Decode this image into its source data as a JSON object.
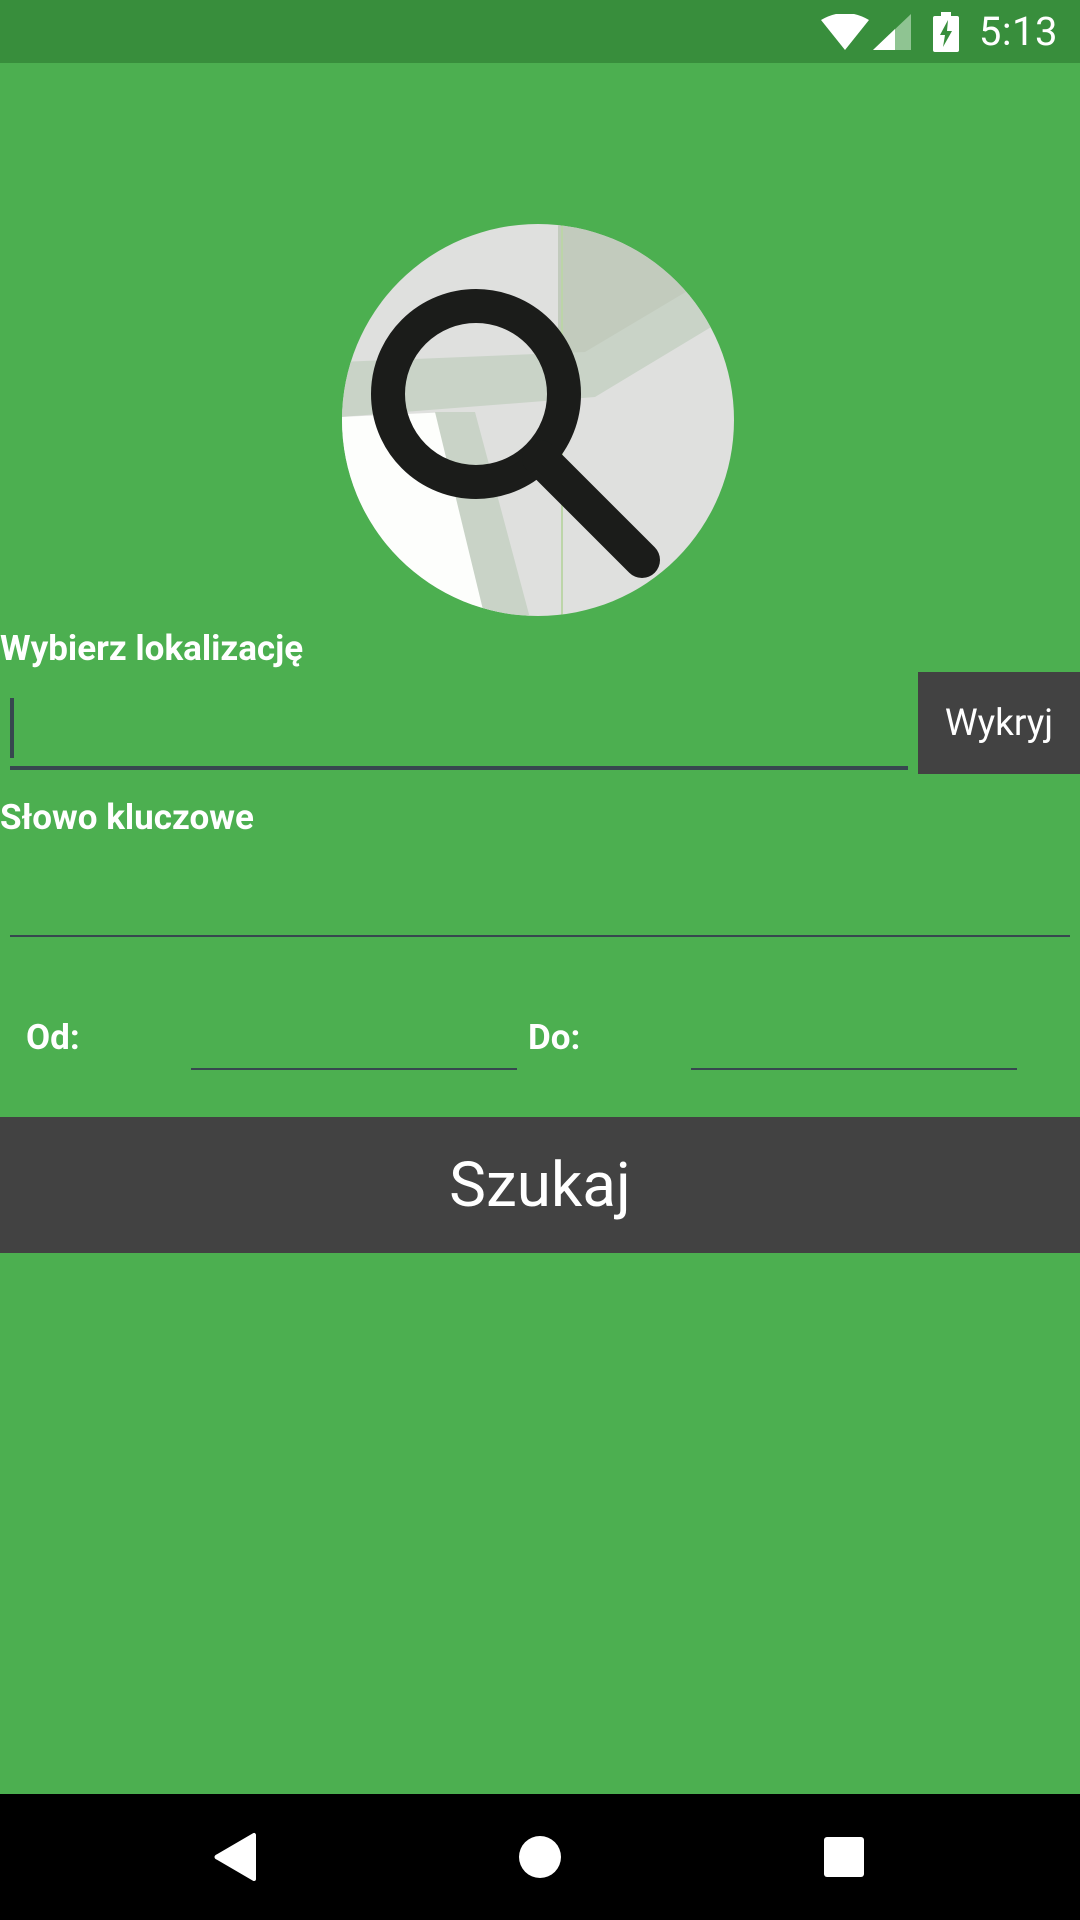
{
  "status_bar": {
    "time": "5:13",
    "icons": [
      "wifi-icon",
      "cell-signal-icon",
      "battery-charging-icon"
    ],
    "background": "#388e3c"
  },
  "logo": {
    "icon": "map-search-icon"
  },
  "location": {
    "label": "Wybierz lokalizację",
    "value": "",
    "placeholder": "",
    "detect_button": "Wykryj"
  },
  "keyword": {
    "label": "Słowo kluczowe",
    "value": "",
    "placeholder": ""
  },
  "dates": {
    "from_label": "Od:",
    "from_value": "",
    "to_label": "Do:",
    "to_value": ""
  },
  "search_button": "Szukaj",
  "nav_bar": {
    "icons": [
      "back-icon",
      "home-icon",
      "recents-icon"
    ]
  },
  "colors": {
    "background": "#4caf50",
    "button": "#424242",
    "text": "#ffffff"
  }
}
